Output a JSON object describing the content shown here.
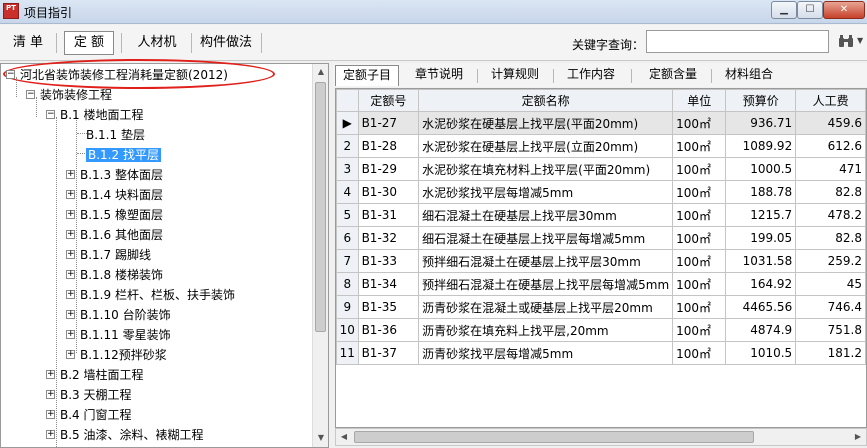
{
  "window": {
    "title": "项目指引",
    "app_icon_text": "PT",
    "icons": {
      "app": "app-logo-icon",
      "minimize": "minimize-icon",
      "maximize": "maximize-icon",
      "close": "close-icon"
    }
  },
  "toolbar": {
    "tabs": [
      {
        "label": "清 单",
        "active": false
      },
      {
        "label": "定 额",
        "active": true
      },
      {
        "label": "人材机",
        "active": false
      },
      {
        "label": "构件做法",
        "active": false
      }
    ],
    "search_label": "关键字查询：",
    "search_value": "",
    "search_icon": "binoculars-icon"
  },
  "tree": {
    "highlight_color": "#e0201a",
    "selected_color": "#3399ff",
    "items": [
      {
        "label": "河北省装饰装修工程消耗量定额(2012)",
        "expander": "−",
        "highlighted": true
      },
      {
        "label": "装饰装修工程",
        "expander": "−"
      },
      {
        "label": "B.1 楼地面工程",
        "expander": "−"
      },
      {
        "label": "B.1.1 垫层",
        "expander": ""
      },
      {
        "label": "B.1.2 找平层",
        "expander": "",
        "selected": true
      },
      {
        "label": "B.1.3 整体面层",
        "expander": "+"
      },
      {
        "label": "B.1.4 块料面层",
        "expander": "+"
      },
      {
        "label": "B.1.5 橡塑面层",
        "expander": "+"
      },
      {
        "label": "B.1.6 其他面层",
        "expander": "+"
      },
      {
        "label": "B.1.7 踢脚线",
        "expander": "+"
      },
      {
        "label": "B.1.8 楼梯装饰",
        "expander": "+"
      },
      {
        "label": "B.1.9 栏杆、栏板、扶手装饰",
        "expander": "+"
      },
      {
        "label": "B.1.10 台阶装饰",
        "expander": "+"
      },
      {
        "label": "B.1.11 零星装饰",
        "expander": "+"
      },
      {
        "label": "B.1.12预拌砂浆",
        "expander": "+"
      },
      {
        "label": "B.2 墙柱面工程",
        "expander": "+"
      },
      {
        "label": "B.3 天棚工程",
        "expander": "+"
      },
      {
        "label": "B.4 门窗工程",
        "expander": "+"
      },
      {
        "label": "B.5 油漆、涂料、裱糊工程",
        "expander": "+"
      }
    ]
  },
  "detail_tabs": [
    {
      "label": "定额子目",
      "active": true
    },
    {
      "label": "章节说明",
      "active": false
    },
    {
      "label": "计算规则",
      "active": false
    },
    {
      "label": "工作内容",
      "active": false
    },
    {
      "label": "定额含量",
      "active": false
    },
    {
      "label": "材料组合",
      "active": false
    }
  ],
  "grid": {
    "current_row_marker": "▶",
    "columns": [
      "定额号",
      "定额名称",
      "单位",
      "预算价",
      "人工费"
    ],
    "rows": [
      {
        "no": "1",
        "code": "B1-27",
        "name": "水泥砂浆在硬基层上找平层(平面20mm)",
        "unit": "100㎡",
        "price": "936.71",
        "labor": "459.6"
      },
      {
        "no": "2",
        "code": "B1-28",
        "name": "水泥砂浆在硬基层上找平层(立面20mm)",
        "unit": "100㎡",
        "price": "1089.92",
        "labor": "612.6"
      },
      {
        "no": "3",
        "code": "B1-29",
        "name": "水泥砂浆在填充材料上找平层(平面20mm)",
        "unit": "100㎡",
        "price": "1000.5",
        "labor": "471"
      },
      {
        "no": "4",
        "code": "B1-30",
        "name": "水泥砂浆找平层每增减5mm",
        "unit": "100㎡",
        "price": "188.78",
        "labor": "82.8"
      },
      {
        "no": "5",
        "code": "B1-31",
        "name": "细石混凝土在硬基层上找平层30mm",
        "unit": "100㎡",
        "price": "1215.7",
        "labor": "478.2"
      },
      {
        "no": "6",
        "code": "B1-32",
        "name": "细石混凝土在硬基层上找平层每增减5mm",
        "unit": "100㎡",
        "price": "199.05",
        "labor": "82.8"
      },
      {
        "no": "7",
        "code": "B1-33",
        "name": "预拌细石混凝土在硬基层上找平层30mm",
        "unit": "100㎡",
        "price": "1031.58",
        "labor": "259.2"
      },
      {
        "no": "8",
        "code": "B1-34",
        "name": "预拌细石混凝土在硬基层上找平层每增减5mm",
        "unit": "100㎡",
        "price": "164.92",
        "labor": "45"
      },
      {
        "no": "9",
        "code": "B1-35",
        "name": "沥青砂浆在混凝土或硬基层上找平层20mm",
        "unit": "100㎡",
        "price": "4465.56",
        "labor": "746.4"
      },
      {
        "no": "10",
        "code": "B1-36",
        "name": "沥青砂浆在填充料上找平层,20mm",
        "unit": "100㎡",
        "price": "4874.9",
        "labor": "751.8"
      },
      {
        "no": "11",
        "code": "B1-37",
        "name": "沥青砂浆找平层每增减5mm",
        "unit": "100㎡",
        "price": "1010.5",
        "labor": "181.2"
      }
    ]
  }
}
